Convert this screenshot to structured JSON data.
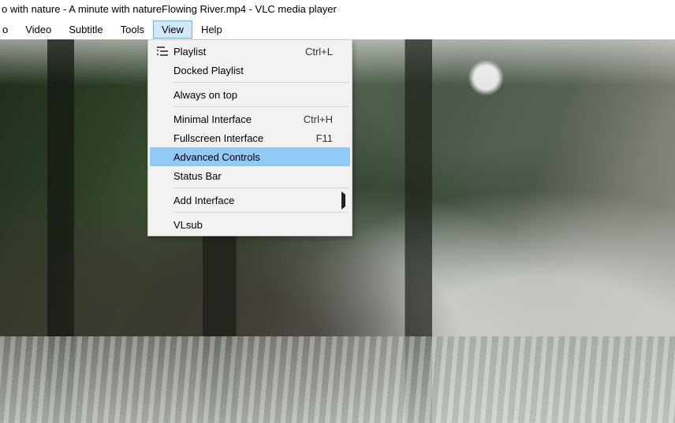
{
  "title": "o with nature - A minute with natureFlowing River.mp4 - VLC media player",
  "menubar": {
    "audio_partial": "o",
    "video": "Video",
    "subtitle": "Subtitle",
    "tools": "Tools",
    "view": "View",
    "help": "Help"
  },
  "view_menu": {
    "playlist": {
      "label": "Playlist",
      "shortcut": "Ctrl+L"
    },
    "docked_playlist": {
      "label": "Docked Playlist"
    },
    "always_on_top": {
      "label": "Always on top"
    },
    "minimal_interface": {
      "label": "Minimal Interface",
      "shortcut": "Ctrl+H"
    },
    "fullscreen_interface": {
      "label": "Fullscreen Interface",
      "shortcut": "F11"
    },
    "advanced_controls": {
      "label": "Advanced Controls"
    },
    "status_bar": {
      "label": "Status Bar"
    },
    "add_interface": {
      "label": "Add Interface"
    },
    "vlsub": {
      "label": "VLsub"
    }
  }
}
